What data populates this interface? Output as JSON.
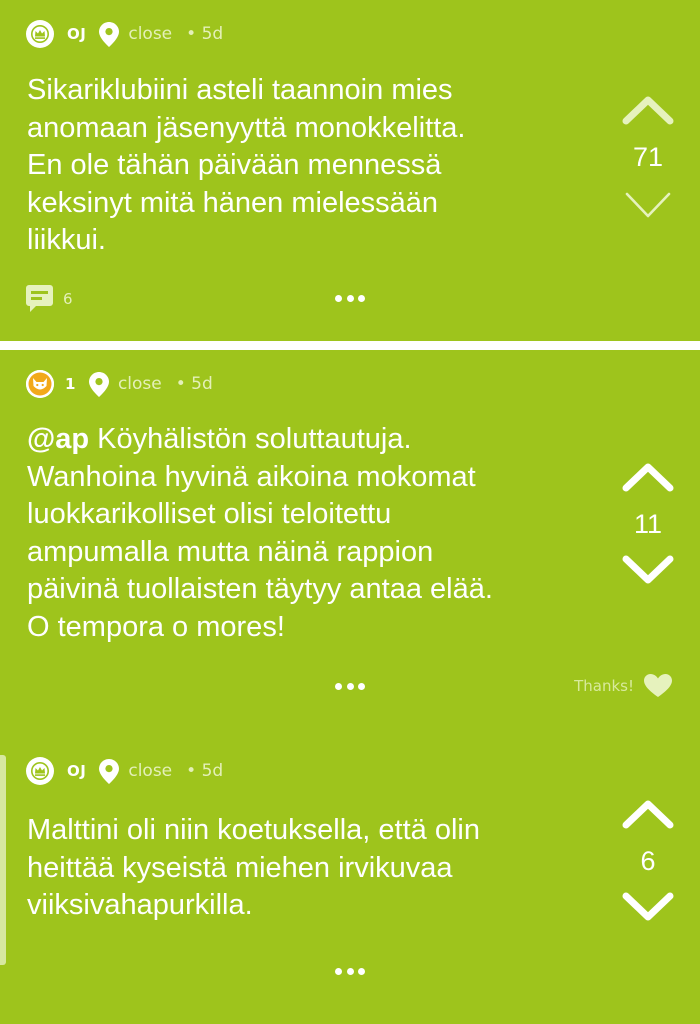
{
  "colors": {
    "background": "#9ec41c",
    "divider": "#ffffff",
    "text": "#ffffff",
    "muted_text": "#e4f0b8",
    "avatar_orange": "#f2a91a"
  },
  "posts": [
    {
      "author": "OJ",
      "avatar_icon": "crown-icon",
      "location": "close",
      "age": "• 5d",
      "text": "Sikariklubiini asteli taannoin mies\nanomaan jäsenyyttä monokkelitta.\nEn ole tähän päivään mennessä\nkeksinyt mitä hänen mielessään\nliikkui.",
      "score": "71",
      "comment_count": "6"
    },
    {
      "author": "1",
      "avatar_icon": "fox-icon",
      "location": "close",
      "age": "• 5d",
      "mention": "@ap",
      "text": " Köyhälistön soluttautuja.\nWanhoina hyvinä aikoina mokomat\nluokkarikolliset olisi teloitettu\nampumalla mutta näinä rappion\npäivinä tuollaisten täytyy antaa elää.\nO tempora o mores!",
      "score": "11",
      "thanks_label": "Thanks!"
    },
    {
      "author": "OJ",
      "avatar_icon": "crown-icon",
      "location": "close",
      "age": "• 5d",
      "text": "Malttini oli niin koetuksella, että olin\nheittää kyseistä miehen irvikuvaa\nviiksivahapurkilla.",
      "score": "6"
    }
  ]
}
